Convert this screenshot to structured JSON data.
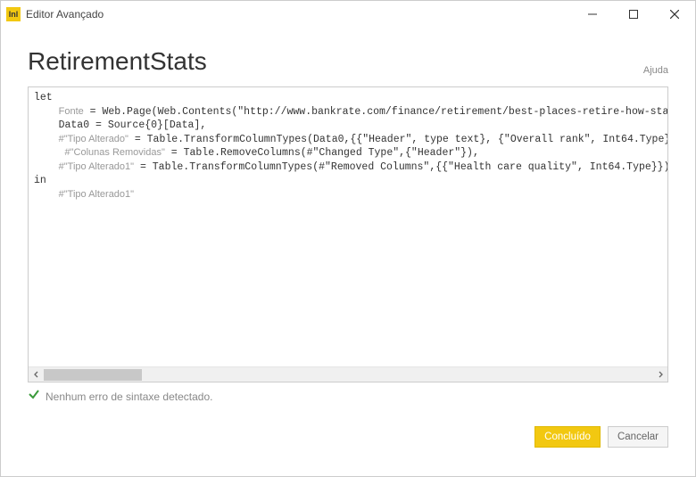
{
  "titlebar": {
    "icon_text": "Inl",
    "title": "Editor Avançado"
  },
  "header": {
    "page_title": "RetirementStats",
    "help_label": "Ajuda"
  },
  "code": {
    "line1": "let",
    "step1": "Fonte",
    "line2a": " = Web.Page(Web.Contents(\"http://www.bankrate.com/finance/retirement/best-places-retire-how-state",
    "line3": "    Data0 = Source{0}[Data],",
    "step2": "#\"Tipo Alterado\"",
    "line4a": " = Table.TransformColumnTypes(Data0,{{\"Header\", type text}, {\"Overall rank\", Int64.Type}",
    "step3": "#\"Colunas Removidas\"",
    "line5a": " = Table.RemoveColumns(#\"Changed Type\",{\"Header\"}),",
    "step4": "#\"Tipo Alterado1\"",
    "line6a": " = Table.TransformColumnTypes(#\"Removed Columns\",{{\"Health care quality\", Int64.Type}})",
    "line7": "in",
    "step5": "#\"Tipo Alterado1\""
  },
  "status": {
    "message": "Nenhum erro de sintaxe detectado."
  },
  "footer": {
    "done_label": "Concluído",
    "cancel_label": "Cancelar"
  }
}
